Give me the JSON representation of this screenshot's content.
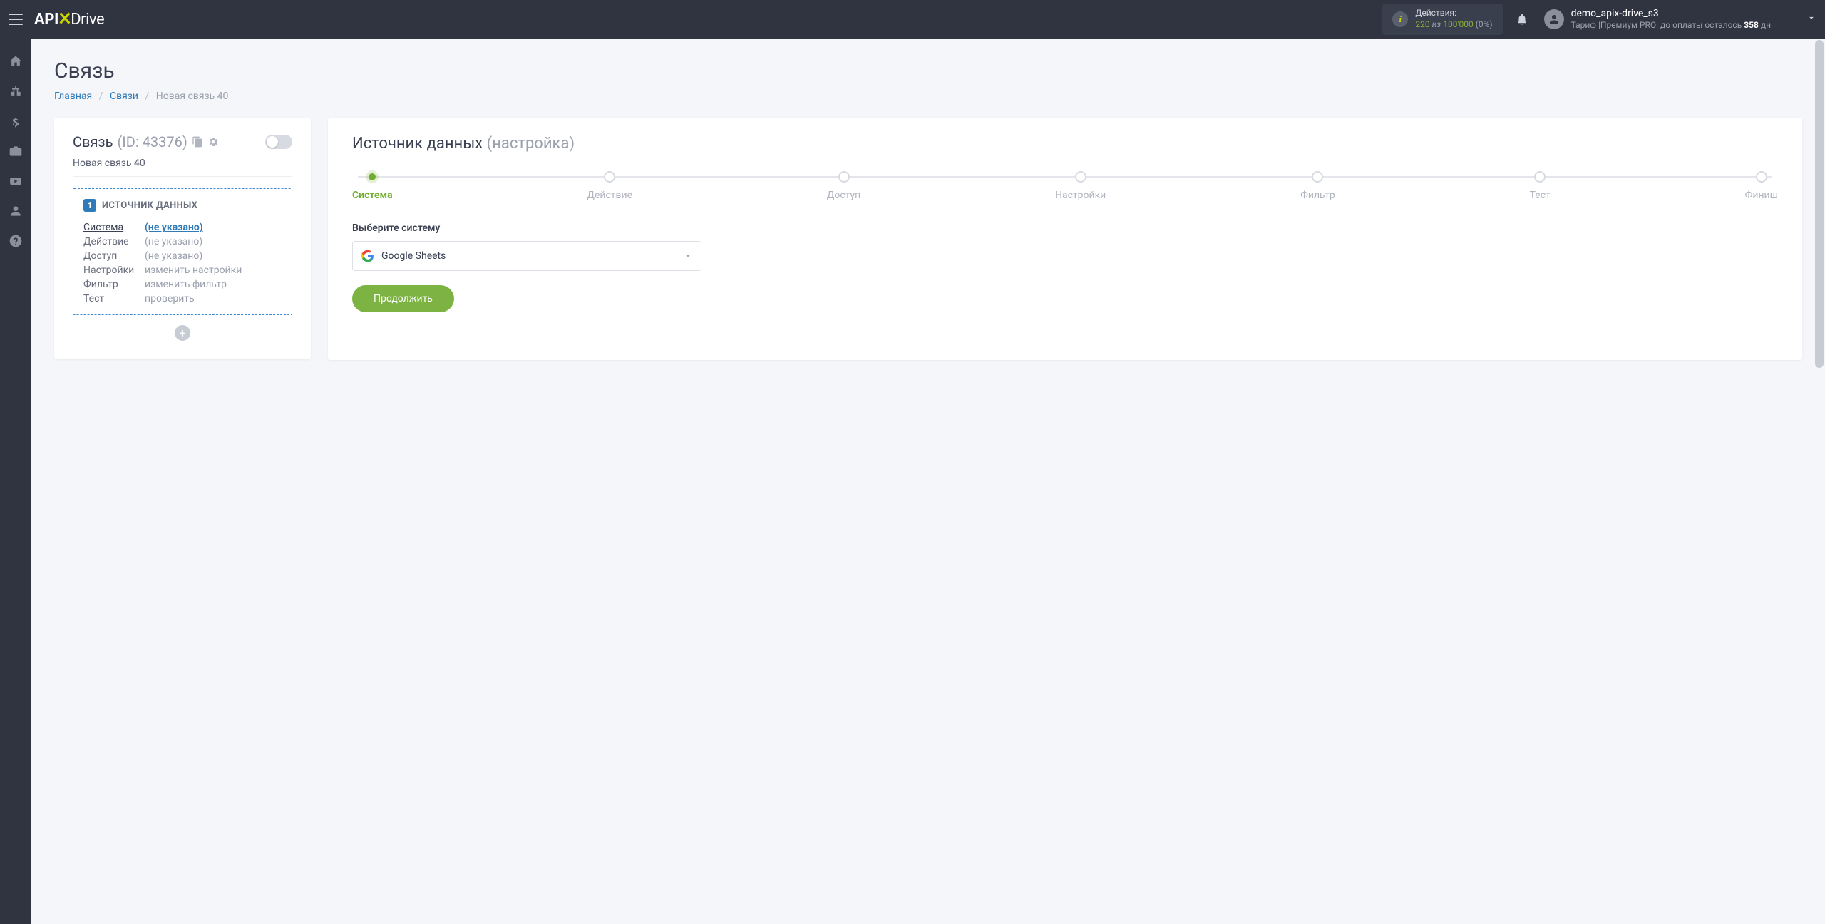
{
  "topbar": {
    "actions_label": "Действия:",
    "actions_used": "220",
    "actions_of_word": "из",
    "actions_total": "100'000",
    "actions_pct": "(0%)",
    "user_name": "demo_apix-drive_s3",
    "tariff_prefix": "Тариф |Премиум PRO| до оплаты осталось ",
    "tariff_days": "358",
    "tariff_suffix": " дн"
  },
  "page": {
    "title": "Связь",
    "crumb_home": "Главная",
    "crumb_links": "Связи",
    "crumb_current": "Новая связь 40"
  },
  "leftcard": {
    "title_main": "Связь",
    "title_id": "(ID: 43376)",
    "conn_name": "Новая связь 40",
    "badge_num": "1",
    "box_title": "ИСТОЧНИК ДАННЫХ",
    "rows": {
      "system_k": "Система",
      "system_v": "(не указано)",
      "action_k": "Действие",
      "action_v": "(не указано)",
      "access_k": "Доступ",
      "access_v": "(не указано)",
      "settings_k": "Настройки",
      "settings_v": "изменить настройки",
      "filter_k": "Фильтр",
      "filter_v": "изменить фильтр",
      "test_k": "Тест",
      "test_v": "проверить"
    }
  },
  "rightcard": {
    "title_main": "Источник данных",
    "title_sub": "(настройка)",
    "steps": [
      "Система",
      "Действие",
      "Доступ",
      "Настройки",
      "Фильтр",
      "Тест",
      "Финиш"
    ],
    "field_label": "Выберите систему",
    "select_value": "Google Sheets",
    "continue_btn": "Продолжить"
  }
}
